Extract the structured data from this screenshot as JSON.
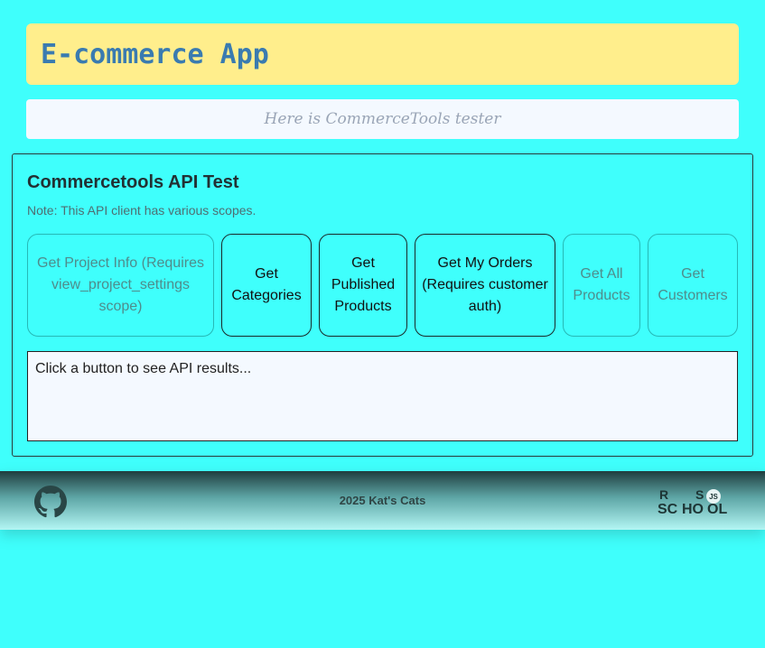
{
  "header": {
    "title": "E-commerce App"
  },
  "subtitle": "Here is CommerceTools tester",
  "panel": {
    "title": "Commercetools API Test",
    "note": "Note: This API client has various scopes.",
    "buttons": [
      {
        "label": "Get Project Info (Requires view_project_settings scope)",
        "enabled": false
      },
      {
        "label": "Get Categories",
        "enabled": true
      },
      {
        "label": "Get Published Products",
        "enabled": true
      },
      {
        "label": "Get My Orders (Requires customer auth)",
        "enabled": true
      },
      {
        "label": "Get All Products",
        "enabled": false
      },
      {
        "label": "Get Customers",
        "enabled": false
      }
    ],
    "result_text": "Click a button to see API results..."
  },
  "footer": {
    "copyright": "2025 Kat's Cats",
    "github_icon": "github-icon",
    "logo": "rs-school-logo",
    "logo_text": {
      "r": "R",
      "s": "S",
      "sc": "SC",
      "ho": "HO",
      "ol": "OL",
      "js": "JS"
    }
  },
  "colors": {
    "background": "#3ffffc",
    "header_bg": "#ffee8c",
    "header_text": "#3a7bb0",
    "subtitle_bg": "#f4f9ff"
  }
}
